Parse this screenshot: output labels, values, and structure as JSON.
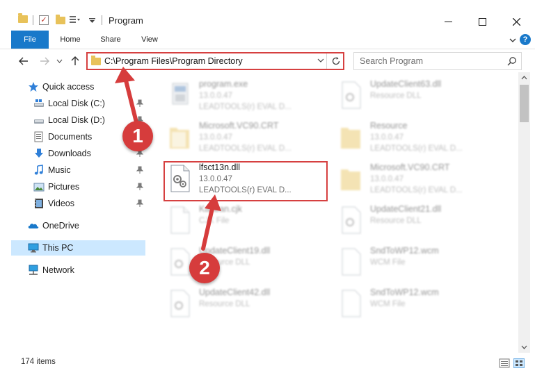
{
  "window": {
    "title": "Program",
    "minimize_icon": "minimize-icon",
    "maximize_icon": "maximize-icon",
    "close_icon": "close-icon"
  },
  "ribbon": {
    "tabs": [
      {
        "label": "File"
      },
      {
        "label": "Home"
      },
      {
        "label": "Share"
      },
      {
        "label": "View"
      }
    ],
    "help_label": "?"
  },
  "address": {
    "path": "C:\\Program Files\\Program Directory"
  },
  "search": {
    "placeholder": "Search Program"
  },
  "navpane": {
    "items": [
      {
        "label": "Quick access"
      },
      {
        "label": "Local Disk (C:)"
      },
      {
        "label": "Local Disk (D:)"
      },
      {
        "label": "Documents"
      },
      {
        "label": "Downloads"
      },
      {
        "label": "Music"
      },
      {
        "label": "Pictures"
      },
      {
        "label": "Videos"
      },
      {
        "label": "OneDrive"
      },
      {
        "label": "This PC"
      },
      {
        "label": "Network"
      }
    ]
  },
  "files": {
    "left": [
      {
        "name": "program.exe",
        "version": "13.0.0.47",
        "desc": "LEADTOOLS(r) EVAL D..."
      },
      {
        "name": "Microsoft.VC90.CRT",
        "version": "13.0.0.47",
        "desc": "LEADTOOLS(r) EVAL D..."
      },
      {
        "name": "lfsct13n.dll",
        "version": "13.0.0.47",
        "desc": "LEADTOOLS(r) EVAL D..."
      },
      {
        "name": "Kanban.cjk",
        "version": "CJK File",
        "desc": ""
      },
      {
        "name": "UpdateClient19.dll",
        "version": "Resource DLL",
        "desc": ""
      },
      {
        "name": "UpdateClient42.dll",
        "version": "Resource DLL",
        "desc": ""
      }
    ],
    "right": [
      {
        "name": "UpdateClient63.dll",
        "version": "Resource DLL",
        "desc": ""
      },
      {
        "name": "Resource",
        "version": "13.0.0.47",
        "desc": "LEADTOOLS(r) EVAL D..."
      },
      {
        "name": "Microsoft.VC90.CRT",
        "version": "13.0.0.47",
        "desc": "LEADTOOLS(r) EVAL D..."
      },
      {
        "name": "UpdateClient21.dll",
        "version": "Resource DLL",
        "desc": ""
      },
      {
        "name": "SndToWP12.wcm",
        "version": "WCM File",
        "desc": ""
      },
      {
        "name": "SndToWP12.wcm",
        "version": "WCM File",
        "desc": ""
      }
    ]
  },
  "status": {
    "count": "174 items"
  },
  "annotations": {
    "step1": "1",
    "step2": "2"
  },
  "colors": {
    "accent": "#1979ca",
    "annotation_red": "#d63c3c",
    "selection": "#cce8ff"
  }
}
